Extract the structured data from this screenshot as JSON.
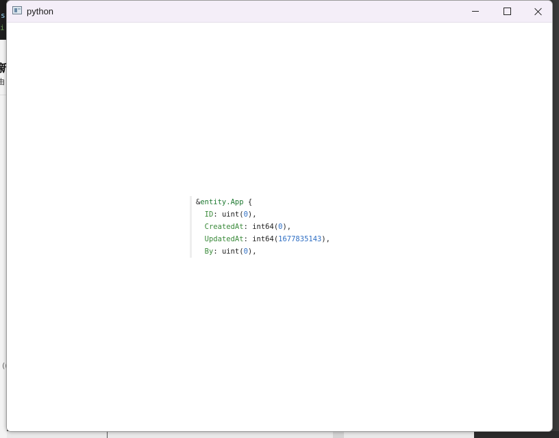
{
  "window": {
    "title": "python",
    "controls": {
      "minimize": "minimize",
      "maximize": "maximize",
      "close": "close"
    }
  },
  "code": {
    "lines": [
      {
        "tokens": [
          {
            "t": "&",
            "k": "plain"
          },
          {
            "t": "entity.App",
            "k": "type"
          },
          {
            "t": " {",
            "k": "plain"
          }
        ]
      },
      {
        "tokens": [
          {
            "t": "  ",
            "k": "plain"
          },
          {
            "t": "ID",
            "k": "field"
          },
          {
            "t": ": uint(",
            "k": "plain"
          },
          {
            "t": "0",
            "k": "num"
          },
          {
            "t": "),",
            "k": "plain"
          }
        ]
      },
      {
        "tokens": [
          {
            "t": "  ",
            "k": "plain"
          },
          {
            "t": "CreatedAt",
            "k": "field"
          },
          {
            "t": ": int64(",
            "k": "plain"
          },
          {
            "t": "0",
            "k": "num"
          },
          {
            "t": "),",
            "k": "plain"
          }
        ]
      },
      {
        "tokens": [
          {
            "t": "  ",
            "k": "plain"
          },
          {
            "t": "UpdatedAt",
            "k": "field"
          },
          {
            "t": ": int64(",
            "k": "plain"
          },
          {
            "t": "1677835143",
            "k": "num"
          },
          {
            "t": "),",
            "k": "plain"
          }
        ]
      },
      {
        "tokens": [
          {
            "t": "  ",
            "k": "plain"
          },
          {
            "t": "By",
            "k": "field"
          },
          {
            "t": ": uint(",
            "k": "plain"
          },
          {
            "t": "0",
            "k": "num"
          },
          {
            "t": "),",
            "k": "plain"
          }
        ]
      }
    ]
  },
  "background": {
    "left_fragments": [
      "s",
      "i",
      "新",
      "由",
      "(("
    ]
  },
  "colors": {
    "titlebar": "#f4eef8",
    "type_token": "#1f7a32",
    "field_token": "#3a8a3a",
    "number_token": "#2f6fc4"
  }
}
